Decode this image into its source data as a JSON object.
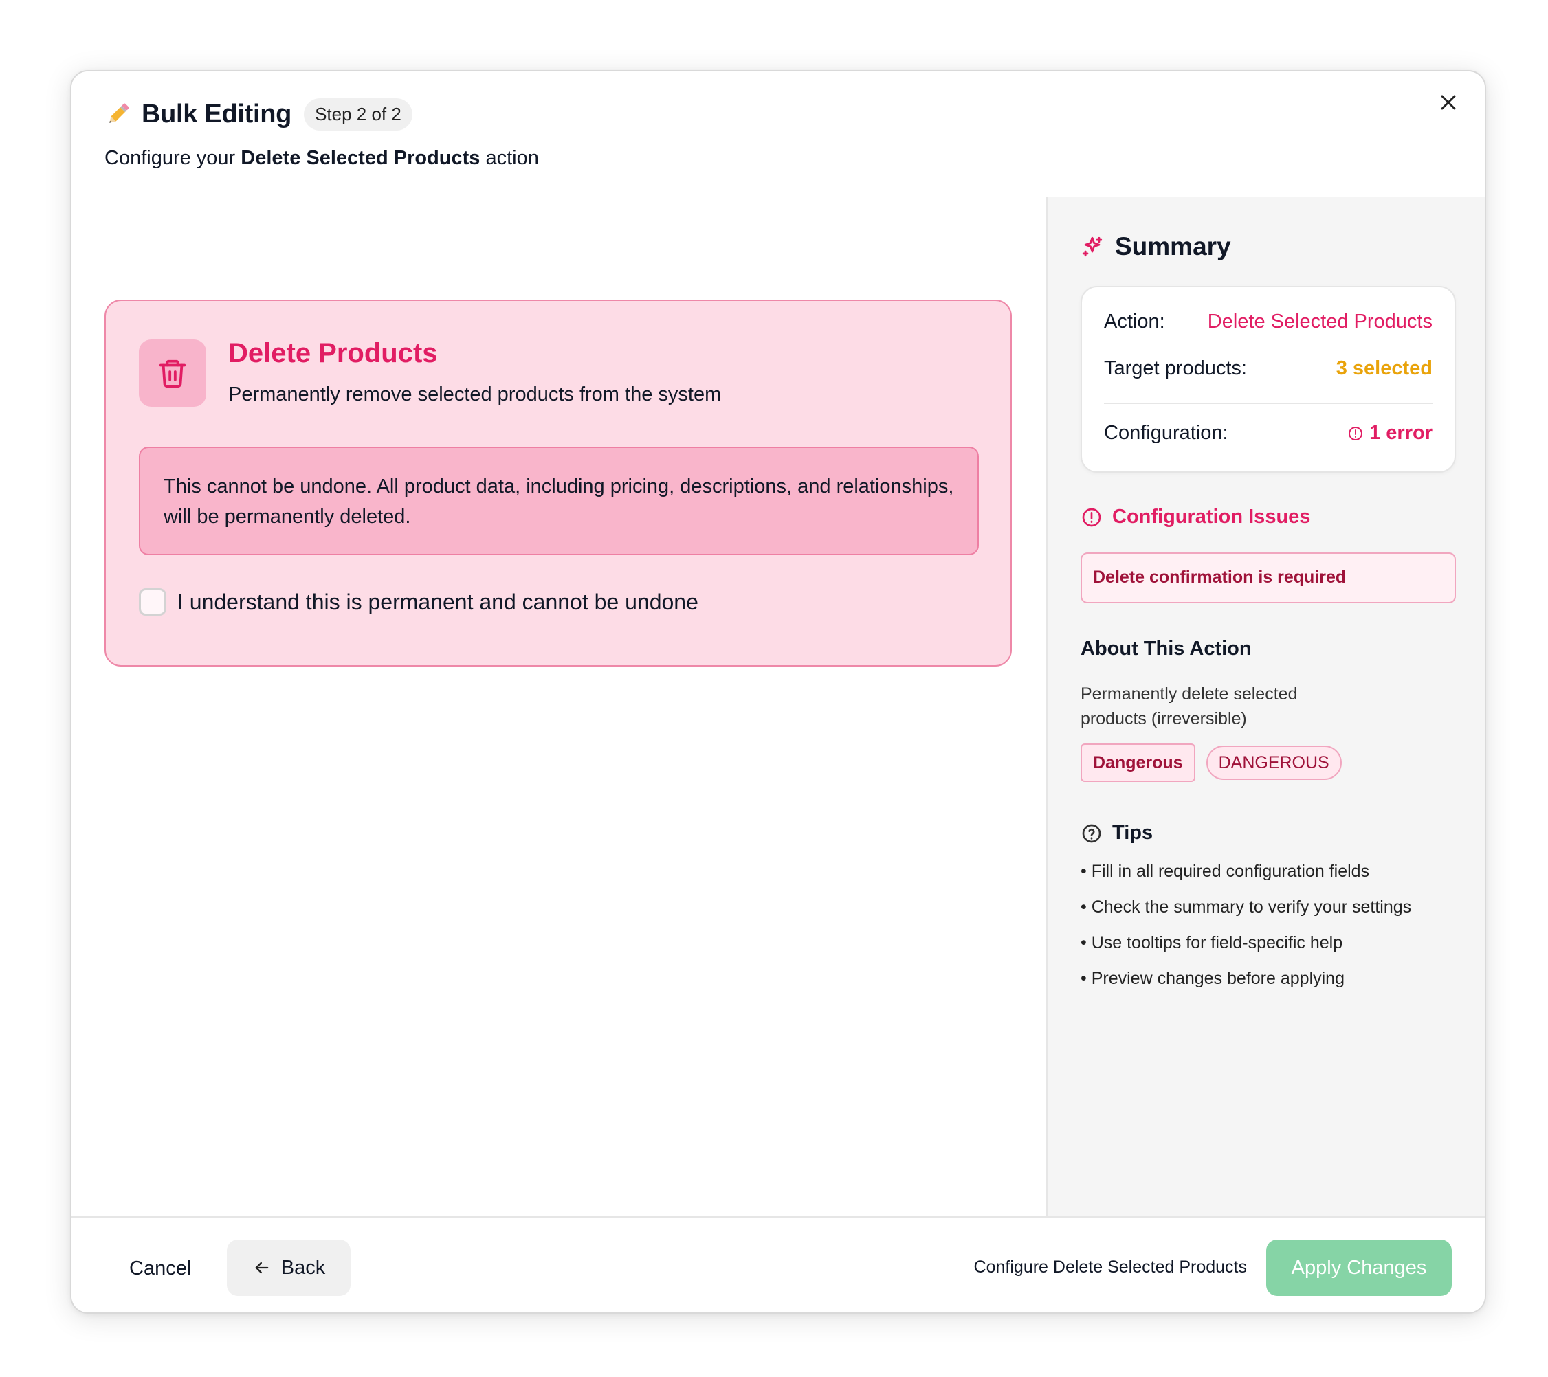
{
  "header": {
    "icon": "pencil-icon",
    "title": "Bulk Editing",
    "step": "Step 2 of 2",
    "subtitle_prefix": "Configure your ",
    "subtitle_bold": "Delete Selected Products",
    "subtitle_suffix": " action"
  },
  "action_card": {
    "icon": "trash-icon",
    "title": "Delete Products",
    "description": "Permanently remove selected products from the system",
    "warning": "This cannot be undone. All product data, including pricing, descriptions, and relationships, will be permanently deleted.",
    "confirm_label": "I understand this is permanent and cannot be undone",
    "confirm_checked": false
  },
  "sidebar": {
    "summary_title": "Summary",
    "summary_icon": "sparkles-icon",
    "summary": {
      "action_label": "Action:",
      "action_value": "Delete Selected Products",
      "target_label": "Target products:",
      "target_value": "3 selected",
      "config_label": "Configuration:",
      "config_value": "1 error"
    },
    "issues_title": "Configuration Issues",
    "issues": [
      "Delete confirmation is required"
    ],
    "about_title": "About This Action",
    "about_desc": "Permanently delete selected products (irreversible)",
    "badges": [
      "Dangerous",
      "DANGEROUS"
    ],
    "tips_title": "Tips",
    "tips": [
      "Fill in all required configuration fields",
      "Check the summary to verify your settings",
      "Use tooltips for field-specific help",
      "Preview changes before applying"
    ]
  },
  "footer": {
    "cancel_label": "Cancel",
    "back_label": "Back",
    "hint": "Configure Delete Selected Products",
    "apply_label": "Apply Changes"
  },
  "colors": {
    "accent_pink": "#e11d63",
    "card_bg": "#fddce6",
    "amber": "#e9a30b",
    "apply_green": "#86d4a6"
  }
}
